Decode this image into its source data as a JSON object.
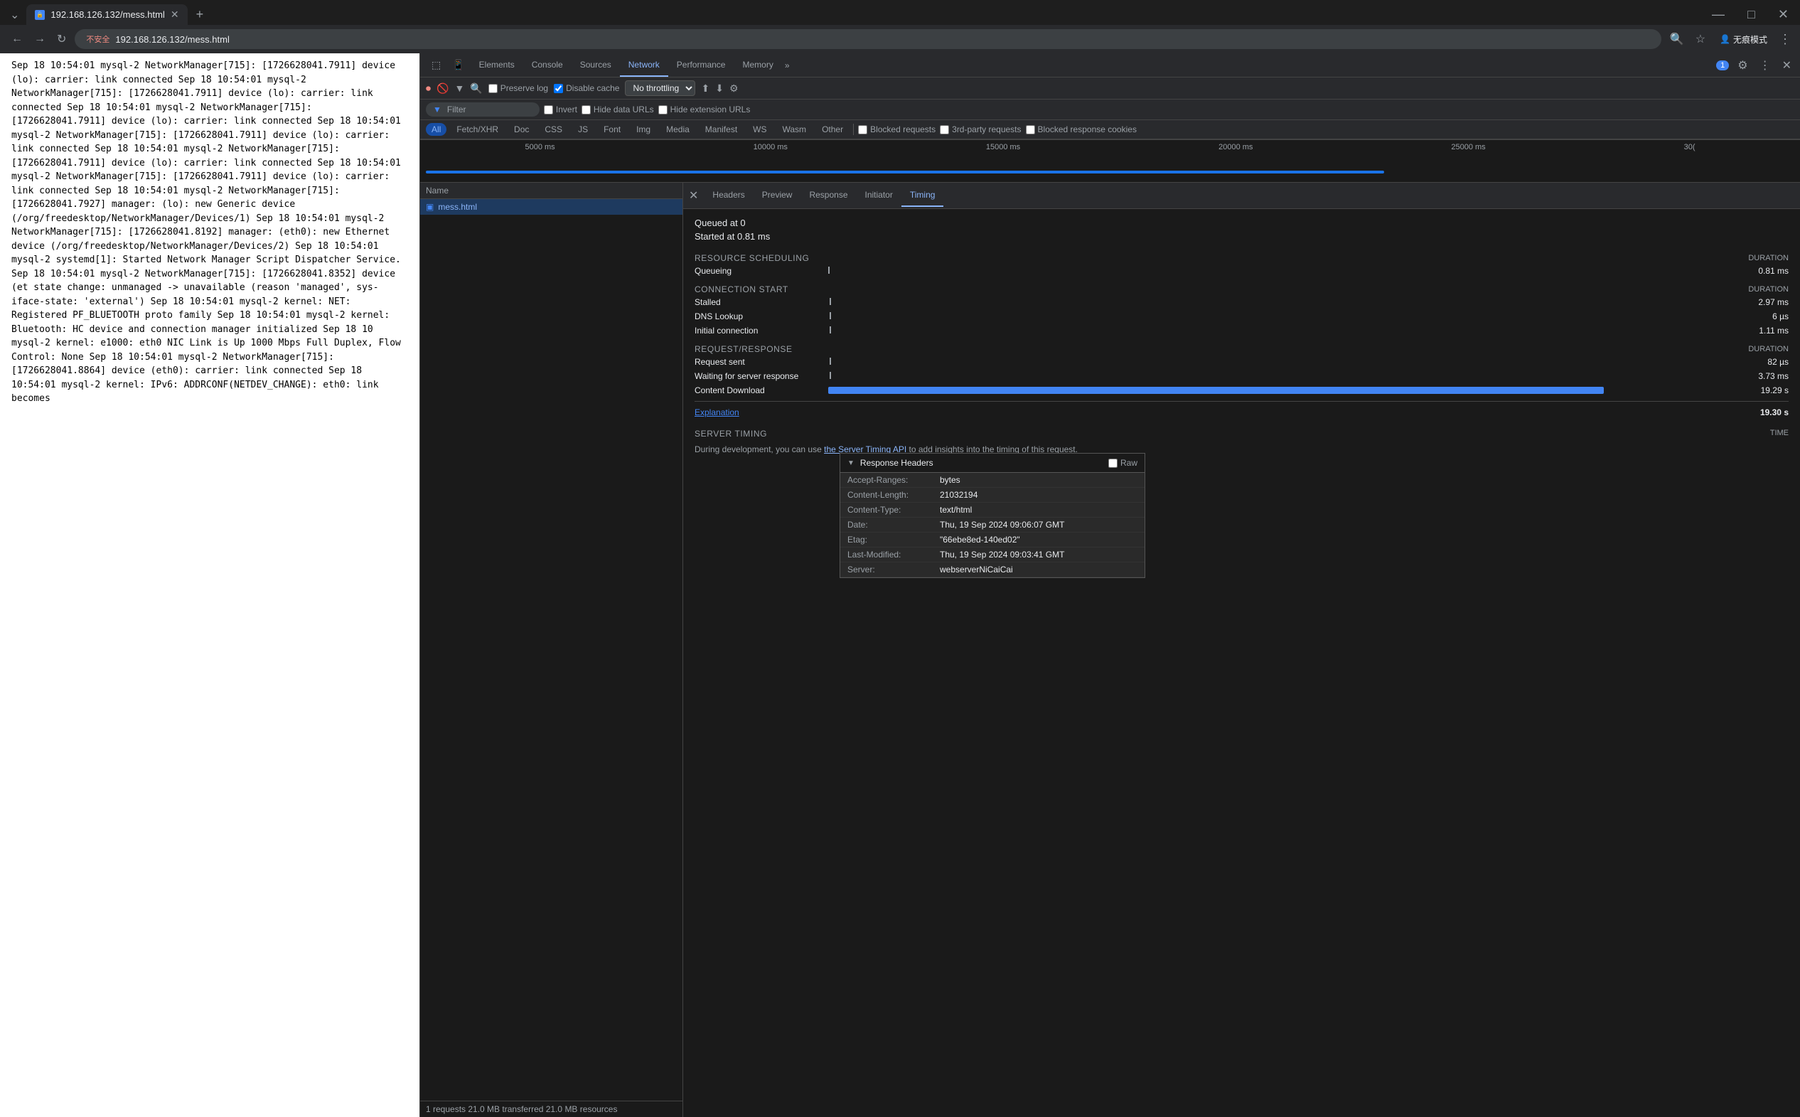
{
  "browser": {
    "tab_url": "192.168.126.132/mess.html",
    "tab_title": "192.168.126.132/mess.html",
    "address_warning": "不安全",
    "address_full": "192.168.126.132/mess.html",
    "private_mode": "无痕模式"
  },
  "devtools": {
    "tabs": [
      "Elements",
      "Console",
      "Sources",
      "Network",
      "Performance",
      "Memory",
      "»"
    ],
    "active_tab": "Network",
    "badge": "1",
    "filter_tabs": [
      "All",
      "Fetch/XHR",
      "Doc",
      "CSS",
      "JS",
      "Font",
      "Img",
      "Media",
      "Manifest",
      "WS",
      "Wasm",
      "Other"
    ],
    "active_filter": "All",
    "filter_placeholder": "Filter",
    "checkboxes": {
      "preserve_log": "Preserve log",
      "disable_cache": "Disable cache",
      "invert": "Invert",
      "hide_data_urls": "Hide data URLs",
      "hide_extension_urls": "Hide extension URLs",
      "blocked_requests": "Blocked requests",
      "third_party": "3rd-party requests",
      "blocked_cookies": "Blocked response cookies"
    },
    "throttle": "No throttling",
    "timeline_labels": [
      "5000 ms",
      "10000 ms",
      "15000 ms",
      "20000 ms",
      "25000 ms",
      "30("
    ]
  },
  "network": {
    "column_name": "Name",
    "request": {
      "icon": "■",
      "name": "mess.html"
    },
    "status_bar": "1 requests    21.0 MB transferred    21.0 MB resources"
  },
  "response_headers": {
    "title": "Response Headers",
    "raw_label": "Raw",
    "headers": [
      {
        "key": "Accept-Ranges:",
        "value": "bytes"
      },
      {
        "key": "Content-Length:",
        "value": "21032194"
      },
      {
        "key": "Content-Type:",
        "value": "text/html"
      },
      {
        "key": "Date:",
        "value": "Thu, 19 Sep 2024 09:06:07 GMT"
      },
      {
        "key": "Etag:",
        "value": "\"66ebe8ed-140ed02\""
      },
      {
        "key": "Last-Modified:",
        "value": "Thu, 19 Sep 2024 09:03:41 GMT"
      },
      {
        "key": "Server:",
        "value": "webserverNiCaiCai"
      }
    ]
  },
  "detail": {
    "close_label": "×",
    "tabs": [
      "Headers",
      "Preview",
      "Response",
      "Initiator",
      "Timing"
    ],
    "active_tab": "Timing",
    "timing": {
      "queued_at": "Queued at 0",
      "started_at": "Started at 0.81 ms",
      "sections": [
        {
          "title": "Resource Scheduling",
          "duration_label": "DURATION",
          "rows": [
            {
              "label": "Queueing",
              "value": "0.81 ms",
              "bar_color": "green",
              "bar_left": "0%",
              "bar_width": "5%"
            }
          ]
        },
        {
          "title": "Connection Start",
          "duration_label": "DURATION",
          "rows": [
            {
              "label": "Stalled",
              "value": "2.97 ms",
              "bar_color": "orange",
              "bar_left": "0%",
              "bar_width": "8%"
            },
            {
              "label": "DNS Lookup",
              "value": "6 µs",
              "bar_color": "blue",
              "bar_left": "8%",
              "bar_width": "1%"
            },
            {
              "label": "Initial connection",
              "value": "1.11 ms",
              "bar_color": "orange",
              "bar_left": "9%",
              "bar_width": "4%"
            }
          ]
        },
        {
          "title": "Request/Response",
          "duration_label": "DURATION",
          "rows": [
            {
              "label": "Request sent",
              "value": "82 µs",
              "bar_color": "green",
              "bar_left": "13%",
              "bar_width": "1%"
            },
            {
              "label": "Waiting for server response",
              "value": "3.73 ms",
              "bar_color": "green",
              "bar_left": "14%",
              "bar_width": "5%"
            },
            {
              "label": "Content Download",
              "value": "19.29 s",
              "bar_color": "blue",
              "bar_left": "19%",
              "bar_width": "60%"
            }
          ]
        }
      ],
      "total_label": "Explanation",
      "total_value": "19.30 s",
      "server_timing_title": "Server Timing",
      "server_timing_time_label": "TIME",
      "server_note": "During development, you can use the Server Timing API to add insights into the timing of this request."
    }
  },
  "page_content": "Sep 18 10:54:01 mysql-2 NetworkManager[715]: [1726628041.7911] device (lo): carrier: link connected Sep 18 10:54:01 mysql-2 NetworkManager[715]: [1726628041.7911] device (lo): carrier: link connected Sep 18 10:54:01 mysql-2 NetworkManager[715]: [1726628041.7911] device (lo): carrier: link connected Sep 18 10:54:01 mysql-2 NetworkManager[715]: [1726628041.7911] device (lo): carrier: link connected Sep 18 10:54:01 mysql-2 NetworkManager[715]: [1726628041.7911] device (lo): carrier: link connected Sep 18 10:54:01 mysql-2 NetworkManager[715]: [1726628041.7911] device (lo): carrier: link connected Sep 18 10:54:01 mysql-2 NetworkManager[715]: [1726628041.7927] manager: (lo): new Generic device (/org/freedesktop/NetworkManager/Devices/1) Sep 18 10:54:01 mysql-2 NetworkManager[715]: [1726628041.8192] manager: (eth0): new Ethernet device (/org/freedesktop/NetworkManager/Devices/2) Sep 18 10:54:01 mysql-2 systemd[1]: Started Network Manager Script Dispatcher Service. Sep 18 10:54:01 mysql-2 NetworkManager[715]: [1726628041.8352] device (et state change: unmanaged -> unavailable (reason 'managed', sys-iface-state: 'external') Sep 18 10:54:01 mysql-2 kernel: NET: Registered PF_BLUETOOTH proto family Sep 18 10:54:01 mysql-2 kernel: Bluetooth: HC device and connection manager initialized Sep 18 10 mysql-2 kernel: e1000: eth0 NIC Link is Up 1000 Mbps Full Duplex, Flow Control: None Sep 18 10:54:01 mysql-2 NetworkManager[715]: [1726628041.8864] device (eth0): carrier: link connected Sep 18 10:54:01 mysql-2 kernel: IPv6: ADDRCONF(NETDEV_CHANGE): eth0: link becomes"
}
